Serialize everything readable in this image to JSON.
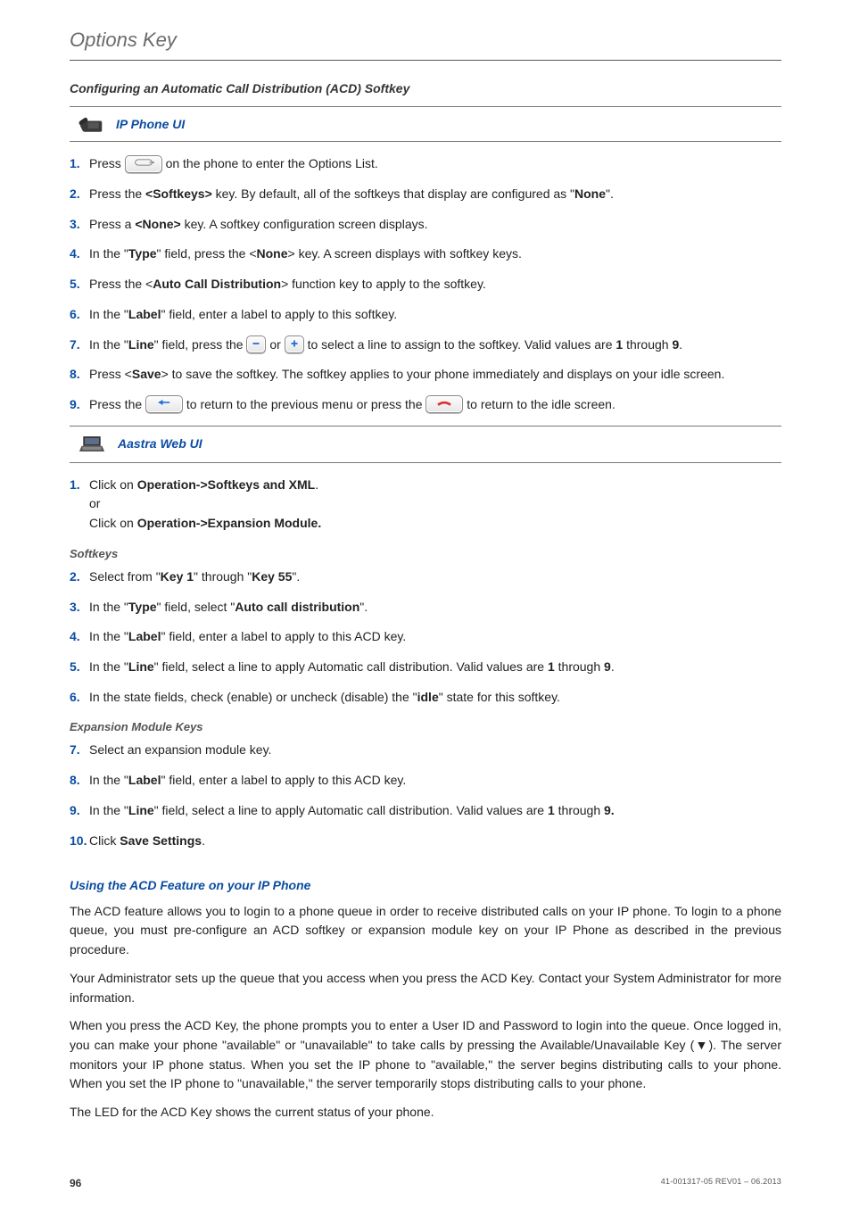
{
  "page_title": "Options Key",
  "section1_title": "Configuring an Automatic Call Distribution (ACD) Softkey",
  "ip_phone_ui_label": "IP Phone UI",
  "aastra_web_ui_label": "Aastra Web UI",
  "ip_steps": {
    "s1a": "Press ",
    "s1b": " on the phone to enter the Options List.",
    "s2a": "Press the ",
    "s2b": "<Softkeys>",
    "s2c": " key. By default, all of the softkeys that display are configured as \"",
    "s2d": "None",
    "s2e": "\".",
    "s3a": "Press a ",
    "s3b": "<None>",
    "s3c": " key. A softkey configuration screen displays.",
    "s4a": "In the \"",
    "s4b": "Type",
    "s4c": "\" field, press the <",
    "s4d": "None",
    "s4e": "> key. A screen displays with softkey keys.",
    "s5a": "Press the <",
    "s5b": "Auto Call Distribution",
    "s5c": "> function key to apply to the softkey.",
    "s6a": "In the \"",
    "s6b": "Label",
    "s6c": "\" field, enter a label to apply to this softkey.",
    "s7a": "In the \"",
    "s7b": "Line",
    "s7c": "\" field, press the ",
    "s7d": " or ",
    "s7e": " to select a line to assign to the softkey. Valid values are ",
    "s7f": "1",
    "s7g": " through ",
    "s7h": "9",
    "s7i": ".",
    "s8a": "Press <",
    "s8b": "Save",
    "s8c": "> to save the softkey. The softkey applies to your phone immediately and displays on your idle screen.",
    "s9a": "Press the ",
    "s9b": " to return to the previous menu or press the ",
    "s9c": " to return to the idle screen."
  },
  "web_steps": {
    "w1a": "Click on ",
    "w1b": "Operation->Softkeys and XML",
    "w1c": ".",
    "w1_or": "or",
    "w1d": "Click on ",
    "w1e": "Operation->Expansion Module.",
    "softkeys_heading": "Softkeys",
    "w2a": "Select from \"",
    "w2b": "Key 1",
    "w2c": "\" through \"",
    "w2d": "Key 55",
    "w2e": "\".",
    "w3a": "In the \"",
    "w3b": "Type",
    "w3c": "\" field, select \"",
    "w3d": "Auto call distribution",
    "w3e": "\".",
    "w4a": "In the \"",
    "w4b": "Label",
    "w4c": "\" field, enter a label to apply to this ACD key.",
    "w5a": "In the \"",
    "w5b": "Line",
    "w5c": "\" field, select a line to apply Automatic call distribution. Valid values are ",
    "w5d": "1",
    "w5e": " through ",
    "w5f": "9",
    "w5g": ".",
    "w6a": "In the state fields, check (enable) or uncheck (disable) the \"",
    "w6b": "idle",
    "w6c": "\" state for this softkey.",
    "expansion_heading": "Expansion Module Keys",
    "w7": "Select an expansion module key.",
    "w8a": "In the \"",
    "w8b": "Label",
    "w8c": "\" field, enter a label to apply to this ACD key.",
    "w9a": "In the \"",
    "w9b": "Line",
    "w9c": "\" field, select a line to apply Automatic call distribution. Valid values are ",
    "w9d": "1",
    "w9e": " through ",
    "w9f": "9.",
    "w10a": "Click ",
    "w10b": "Save Settings",
    "w10c": "."
  },
  "using_heading": "Using the ACD Feature on your IP Phone",
  "para1": "The ACD feature allows you to login to a phone queue in order to receive distributed calls on your IP phone. To login to a phone queue, you must pre-configure an ACD softkey or expansion module key on your IP Phone as described in the previous procedure.",
  "para2": "Your Administrator sets up the queue that you access when you press the ACD Key. Contact your System Administrator for more information.",
  "para3": "When you press the ACD Key, the phone prompts you to enter a User ID and Password to login into the queue. Once logged in, you can make your phone \"available\" or \"unavailable\" to take calls by pressing the Available/Unavailable Key (▼). The server monitors your IP phone status. When you set the IP phone to \"available,\" the server begins distributing calls to your phone. When you set the IP phone to \"unavailable,\" the server temporarily stops distributing calls to your phone.",
  "para4": "The LED for the ACD Key shows the current status of your phone.",
  "footer_page": "96",
  "footer_rev": "41-001317-05 REV01 – 06.2013"
}
